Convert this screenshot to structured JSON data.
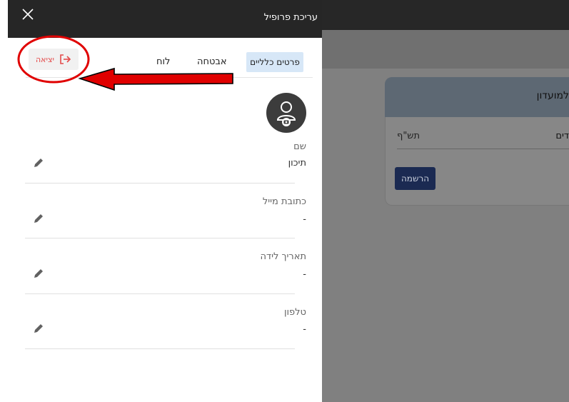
{
  "background_app": {
    "card_title": "למועדון",
    "row_right": "דים",
    "row_left": "תש\"ף",
    "register_button": "הרשמה"
  },
  "panel": {
    "title": "עריכת פרופיל",
    "close_glyph": "X",
    "tabs": [
      {
        "label": "פרטים כלליים",
        "active": true
      },
      {
        "label": "אבטחה",
        "active": false
      },
      {
        "label": "לוח",
        "active": false
      }
    ],
    "logout_label": "יציאה",
    "fields": [
      {
        "label": "שם",
        "value": "תיכון"
      },
      {
        "label": "כתובת מייל",
        "value": "-"
      },
      {
        "label": "תאריך לידה",
        "value": "-"
      },
      {
        "label": "טלפון",
        "value": "-"
      }
    ]
  },
  "colors": {
    "panel_header": "#262626",
    "active_tab": "#d7e7f7",
    "logout_red": "#e44a4a",
    "annotation_red": "#e00000",
    "register_button": "#1b2a52"
  }
}
